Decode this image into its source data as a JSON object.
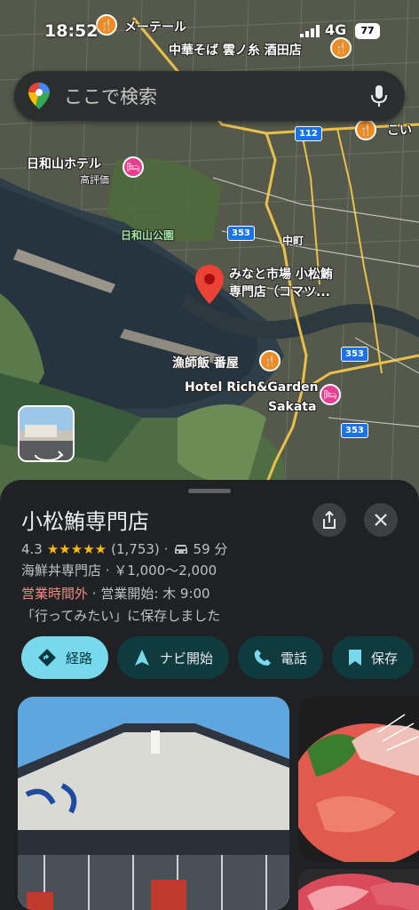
{
  "status_bar": {
    "time": "18:52",
    "network": "4G",
    "battery": "77"
  },
  "search": {
    "placeholder": "ここで検索"
  },
  "map": {
    "labels": {
      "metel": "メーテール",
      "ramen": "中華そば 雲ノ糸 酒田店",
      "hiyoriyama_hotel": "日和山ホテル",
      "high_rating": "高評価",
      "hiyoriyama_park": "日和山公園",
      "nakamachi": "中町",
      "minato_market": "みなと市場 小松鮪",
      "minato_market_2": "専門店（コマツ...",
      "ryoshimeshi": "漁師飯 番屋",
      "hotel_rich": "Hotel Rich&Garden",
      "sakata": "Sakata",
      "koi": "こい"
    },
    "shields": {
      "r112": "112",
      "r353a": "353",
      "r353b": "353",
      "r353c": "353"
    }
  },
  "place": {
    "name": "小松鮪専門店",
    "rating": "4.3",
    "stars": "★★★★★",
    "review_count": "(1,753)",
    "separator": "·",
    "drive_time": "59 分",
    "category_price": "海鮮丼専門店 · ￥1,000～2,000",
    "hours_status": "営業時間外",
    "hours_detail": " · 営業開始: 木 9:00",
    "saved_note": "「行ってみたい」に保存しました"
  },
  "actions": {
    "directions": "経路",
    "navigate": "ナビ開始",
    "call": "電話",
    "save": "保存"
  },
  "colors": {
    "accent": "#78d9ec",
    "action_bg": "#0f3b3e",
    "sheet_bg": "#202124",
    "closed": "#f28b82",
    "star": "#fbbc04",
    "pin": "#ea4335"
  }
}
